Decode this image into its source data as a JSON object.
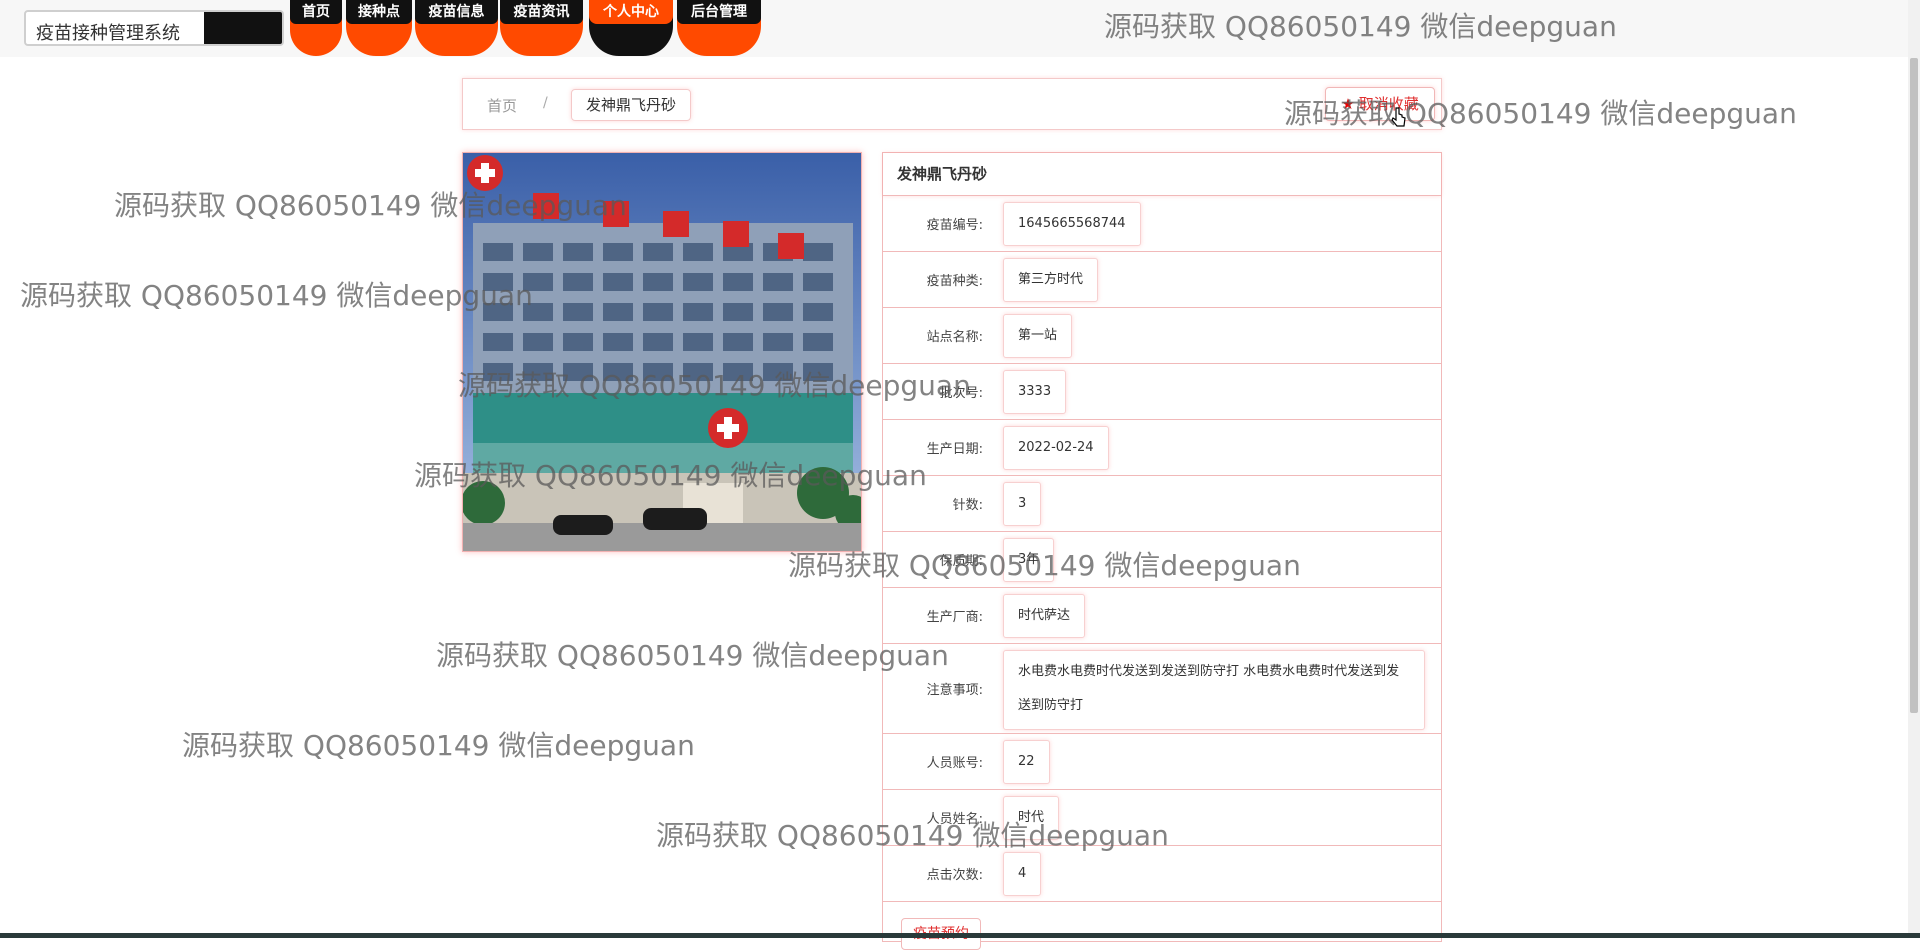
{
  "header": {
    "brand": "疫苗接种管理系统",
    "nav": [
      {
        "label": "首页",
        "active": false
      },
      {
        "label": "接种点",
        "active": false
      },
      {
        "label": "疫苗信息",
        "active": false
      },
      {
        "label": "疫苗资讯",
        "active": false
      },
      {
        "label": "个人中心",
        "active": true
      },
      {
        "label": "后台管理",
        "active": false
      }
    ]
  },
  "breadcrumb": {
    "home": "首页",
    "separator": "/",
    "current": "发神鼎飞丹砂"
  },
  "collect_button": {
    "icon": "star-icon",
    "label": "取消收藏"
  },
  "detail": {
    "title": "发神鼎飞丹砂",
    "fields": [
      {
        "label": "疫苗编号:",
        "value": "1645665568744"
      },
      {
        "label": "疫苗种类:",
        "value": "第三方时代"
      },
      {
        "label": "站点名称:",
        "value": "第一站"
      },
      {
        "label": "批次号:",
        "value": "3333"
      },
      {
        "label": "生产日期:",
        "value": "2022-02-24"
      },
      {
        "label": "针数:",
        "value": "3"
      },
      {
        "label": "保质期:",
        "value": "3年"
      },
      {
        "label": "生产厂商:",
        "value": "时代萨达"
      },
      {
        "label": "注意事项:",
        "value": "水电费水电费时代发送到发送到防守打 水电费水电费时代发送到发送到防守打"
      },
      {
        "label": "人员账号:",
        "value": "22"
      },
      {
        "label": "人员姓名:",
        "value": "时代"
      },
      {
        "label": "点击次数:",
        "value": "4"
      }
    ],
    "bottom_button": "疫苗预约"
  },
  "watermark_text": "源码获取 QQ86050149 微信deepguan",
  "colors": {
    "accent": "#ff4a00",
    "nav_dark": "#111111",
    "border_pink": "#f1b9b9"
  }
}
